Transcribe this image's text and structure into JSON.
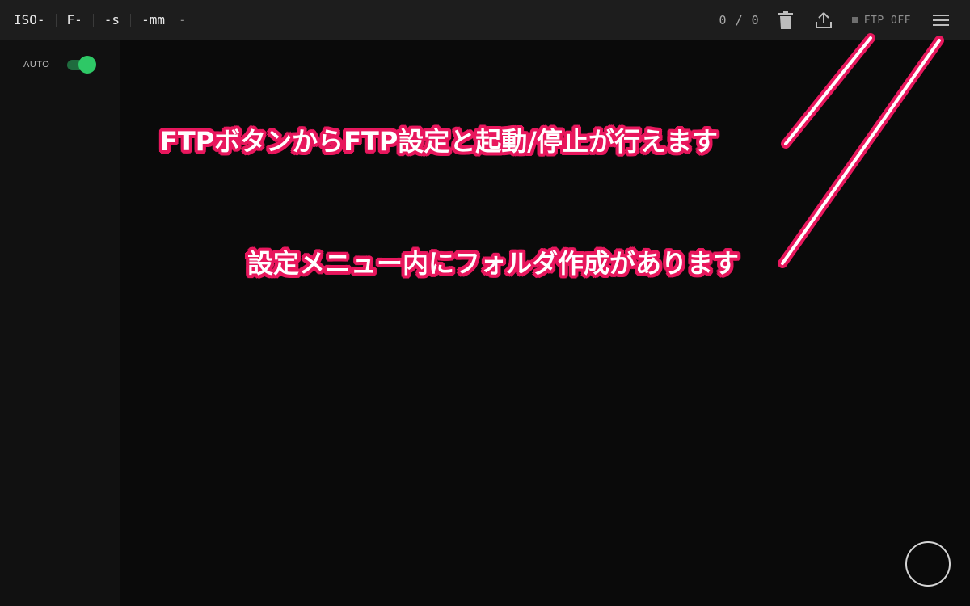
{
  "topbar": {
    "exif": {
      "iso": "ISO-",
      "aperture": "F-",
      "shutter": "-s",
      "focal": "-mm",
      "extra": "-"
    },
    "counter": "0 / 0",
    "trash_icon": "trash-icon",
    "upload_icon": "upload-icon",
    "ftp_label": "FTP OFF",
    "ftp_status_color": "#6e6e6e",
    "menu_icon": "hamburger-menu-icon"
  },
  "sidebar": {
    "auto_label": "AUTO",
    "auto_enabled": true,
    "toggle_color": "#2ec866"
  },
  "annotations": {
    "ftp_note": "FTPボタンからFTP設定と起動/停止が行えます",
    "menu_note": "設定メニュー内にフォルダ作成があります",
    "accent_color": "#e8175d"
  },
  "shutter_icon": "shutter-ring-icon"
}
